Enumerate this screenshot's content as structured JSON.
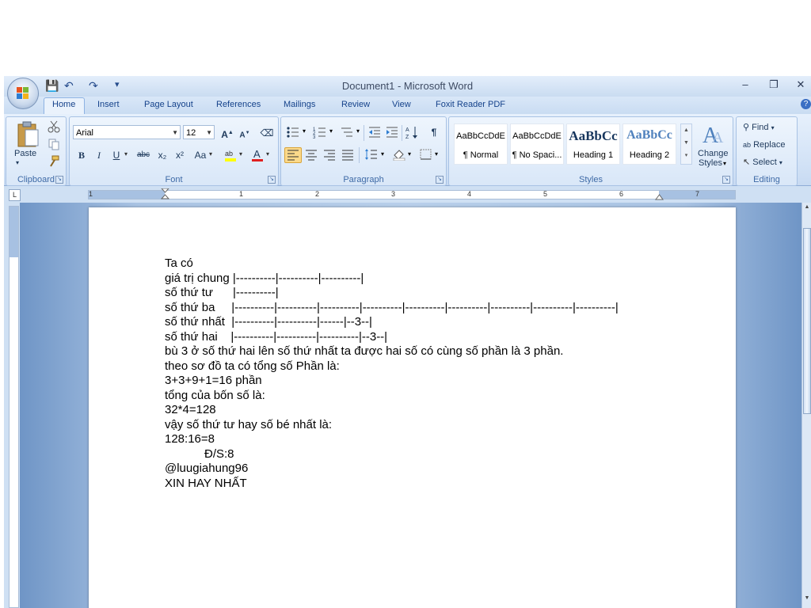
{
  "window": {
    "title": "Document1 - Microsoft Word",
    "minimize": "–",
    "restore": "❐",
    "close": "✕"
  },
  "qat": {
    "save": "💾",
    "undo": "↶",
    "redo": "↷",
    "customize": "▾"
  },
  "tabs": [
    "Home",
    "Insert",
    "Page Layout",
    "References",
    "Mailings",
    "Review",
    "View",
    "Foxit Reader PDF"
  ],
  "help": "?",
  "clipboard": {
    "label": "Clipboard",
    "paste": "Paste"
  },
  "font": {
    "label": "Font",
    "name": "Arial",
    "size": "12",
    "grow": "A",
    "shrink": "A",
    "bold": "B",
    "italic": "I",
    "underline": "U",
    "strike": "abc",
    "subscript": "x₂",
    "superscript": "x²",
    "change_case": "Aa",
    "font_color": "A",
    "highlight_color": "#ffff00",
    "font_color_value": "#e02020"
  },
  "paragraph": {
    "label": "Paragraph",
    "show_marks": "¶"
  },
  "styles": {
    "label": "Styles",
    "items": [
      {
        "sample": "AaBbCcDdE",
        "name": "¶ Normal"
      },
      {
        "sample": "AaBbCcDdE",
        "name": "¶ No Spaci..."
      },
      {
        "sample": "AaBbCc",
        "name": "Heading 1"
      },
      {
        "sample": "AaBbCc",
        "name": "Heading 2"
      }
    ],
    "change_styles_1": "Change",
    "change_styles_2": "Styles",
    "heading_color": "#17365d"
  },
  "editing": {
    "label": "Editing",
    "find": "Find",
    "replace": "Replace",
    "select": "Select"
  },
  "ruler": {
    "tab_selector": "L",
    "numbers": [
      "1",
      "1",
      "2",
      "3",
      "4",
      "5",
      "6",
      "7"
    ]
  },
  "document": {
    "lines": [
      "Ta có",
      "giá trị chung |----------|----------|----------|",
      "số thứ tư      |----------|",
      "số thứ ba     |----------|----------|----------|----------|----------|----------|----------|----------|----------|",
      "số thứ nhất  |----------|----------|------|--3--|",
      "số thứ hai    |----------|----------|----------|--3--|",
      "bù 3 ở số thứ hai lên số thứ nhất ta được hai số có cùng số phần là 3 phần.",
      "theo sơ đồ ta có tổng số Phần là:",
      "3+3+9+1=16 phần",
      "tổng của bốn số là:",
      "32*4=128",
      "vậy số thứ tư hay số bé nhất là:",
      "128:16=8",
      "            Đ/S:8",
      "@luugiahung96",
      "XIN HAY NHẤT"
    ]
  }
}
